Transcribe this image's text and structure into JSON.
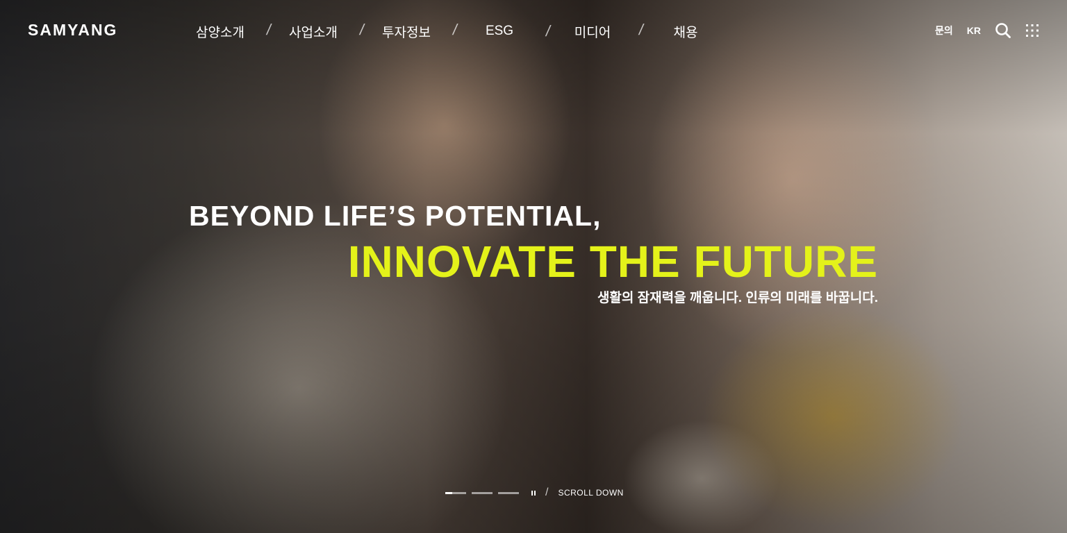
{
  "header": {
    "logo": "SAMYANG",
    "nav": [
      {
        "label": "삼양소개"
      },
      {
        "label": "사업소개"
      },
      {
        "label": "투자정보"
      },
      {
        "label": "ESG"
      },
      {
        "label": "미디어"
      },
      {
        "label": "채용"
      }
    ],
    "nav_separator": "/",
    "util": {
      "contact": "문의",
      "language": "KR",
      "search_icon": "search-icon",
      "menu_icon": "grid-menu-icon"
    }
  },
  "hero": {
    "headline_1": "BEYOND LIFE’S POTENTIAL,",
    "headline_2": "INNOVATE THE FUTURE",
    "subcopy": "생활의 잠재력을 깨웁니다. 인류의 미래를 바꿉니다.",
    "accent_color": "#e4f21a"
  },
  "slider": {
    "slide_count": 3,
    "active_slide": 1,
    "active_progress": 0.33,
    "separator": "/",
    "scroll_label": "SCROLL DOWN"
  }
}
